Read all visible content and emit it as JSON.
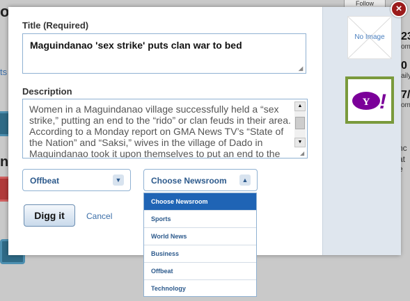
{
  "background": {
    "follow_label": "Follow",
    "fragments": [
      "o",
      "ts",
      "nt",
      "23",
      "om",
      "0",
      "aily",
      "7/",
      "om",
      "nc",
      "at e"
    ]
  },
  "form": {
    "title_label": "Title (Required)",
    "title_value": "Maguindanao 'sex strike' puts clan war to bed",
    "description_label": "Description",
    "description_value": "Women in a Maguindanao village successfully held a “sex strike,” putting an end to the “rido” or clan feuds in their area. According to a Monday report on GMA News TV’s “State of the Nation” and “Saksi,” wives in the village of Dado in Maguindanao took it upon themselves to put an end to the rido in their area.",
    "topic_select_value": "Offbeat",
    "newsroom_select_value": "Choose Newsroom",
    "submit_label": "Digg it",
    "cancel_label": "Cancel"
  },
  "newsroom_dropdown": {
    "options": [
      "Choose Newsroom",
      "Sports",
      "World News",
      "Business",
      "Offbeat",
      "Technology"
    ],
    "selected_index": 0
  },
  "thumbnails": {
    "no_image_label": "No Image",
    "yahoo_logo_text": "Y!"
  },
  "close_label": "×",
  "colors": {
    "accent": "#1f64b5",
    "link": "#3b6ea8",
    "select_text": "#2d5a8c",
    "close": "#9b1b1b",
    "yahoo_purple": "#7b0099",
    "thumb_border": "#7a9a3c"
  }
}
